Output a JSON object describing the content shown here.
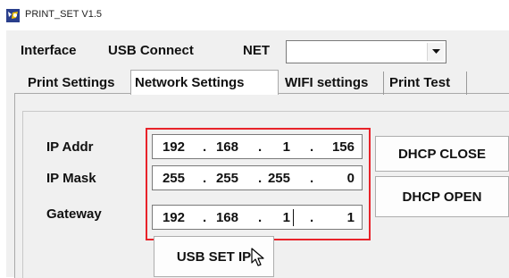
{
  "window": {
    "title": "PRINT_SET V1.5"
  },
  "interface_bar": {
    "interface_label": "Interface",
    "usb_label": "USB Connect",
    "net_label": "NET",
    "net_select_value": ""
  },
  "tabs": [
    {
      "label": "Print Settings",
      "active": false
    },
    {
      "label": "Network Settings",
      "active": true
    },
    {
      "label": "WIFI settings",
      "active": false
    },
    {
      "label": "Print Test",
      "active": false
    }
  ],
  "network": {
    "ip_addr": {
      "label": "IP Addr",
      "octets": [
        "192",
        "168",
        "1",
        "156"
      ]
    },
    "ip_mask": {
      "label": "IP Mask",
      "octets": [
        "255",
        "255",
        "255",
        "0"
      ]
    },
    "gateway": {
      "label": "Gateway",
      "octets": [
        "192",
        "168",
        "1",
        "1"
      ]
    },
    "dot": "."
  },
  "buttons": {
    "dhcp_close": "DHCP CLOSE",
    "dhcp_open": "DHCP OPEN",
    "usb_set_ip": "USB SET IP"
  },
  "colors": {
    "highlight": "#e8232a",
    "panel_bg": "#f0f0f0"
  }
}
